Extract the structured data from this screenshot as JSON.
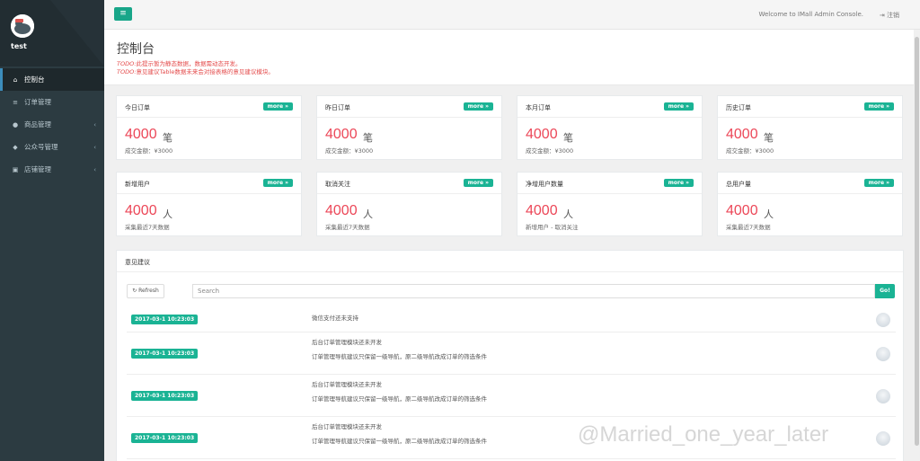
{
  "sidebar": {
    "user": "test",
    "items": [
      {
        "icon": "home-icon",
        "glyph": "⌂",
        "label": "控制台",
        "active": true,
        "has_chevron": false
      },
      {
        "icon": "list-icon",
        "glyph": "≡",
        "label": "订单管理",
        "active": false,
        "has_chevron": false
      },
      {
        "icon": "goods-icon",
        "glyph": "●",
        "label": "商品管理",
        "active": false,
        "has_chevron": true
      },
      {
        "icon": "wechat-icon",
        "glyph": "◆",
        "label": "公众号管理",
        "active": false,
        "has_chevron": true
      },
      {
        "icon": "shop-icon",
        "glyph": "▣",
        "label": "店铺管理",
        "active": false,
        "has_chevron": true
      }
    ]
  },
  "topbar": {
    "menu_glyph": "≡",
    "welcome": "Welcome to IMall Admin Console.",
    "logout": "注销",
    "logout_glyph": "⇥"
  },
  "page": {
    "title": "控制台",
    "todo1_prefix": "TODO:",
    "todo1_text": "此提示暂为静态数据，数据需动态开发。",
    "todo2_prefix": "TODO:",
    "todo2_text": "意见建议Table数据未来会对接表格的意见建议模块。"
  },
  "cards": [
    {
      "title": "今日订单",
      "more": "more »",
      "value": "4000",
      "unit": "笔",
      "sub": "成交金额：¥3000"
    },
    {
      "title": "昨日订单",
      "more": "more »",
      "value": "4000",
      "unit": "笔",
      "sub": "成交金额：¥3000"
    },
    {
      "title": "本月订单",
      "more": "more »",
      "value": "4000",
      "unit": "笔",
      "sub": "成交金额：¥3000"
    },
    {
      "title": "历史订单",
      "more": "more »",
      "value": "4000",
      "unit": "笔",
      "sub": "成交金额：¥3000"
    },
    {
      "title": "新增用户",
      "more": "more »",
      "value": "4000",
      "unit": "人",
      "sub": "采集最近7天数据"
    },
    {
      "title": "取消关注",
      "more": "more »",
      "value": "4000",
      "unit": "人",
      "sub": "采集最近7天数据"
    },
    {
      "title": "净增用户数量",
      "more": "more »",
      "value": "4000",
      "unit": "人",
      "sub": "新增用户 - 取消关注"
    },
    {
      "title": "总用户量",
      "more": "more »",
      "value": "4000",
      "unit": "人",
      "sub": "采集最近7天数据"
    }
  ],
  "feedback": {
    "title": "意见建议",
    "refresh": "Refresh",
    "search_placeholder": "Search",
    "go": "Go!",
    "rows": [
      {
        "date": "2017-03-1 10:23:03",
        "line1": "微信支付还未支持",
        "line2": ""
      },
      {
        "date": "2017-03-1 10:23:03",
        "line1": "后台订单管理模块还未开发",
        "line2": "订单管理导航建议只保留一级导航，原二级导航改成订单的筛选条件"
      },
      {
        "date": "2017-03-1 10:23:03",
        "line1": "后台订单管理模块还未开发",
        "line2": "订单管理导航建议只保留一级导航，原二级导航改成订单的筛选条件"
      },
      {
        "date": "2017-03-1 10:23:03",
        "line1": "后台订单管理模块还未开发",
        "line2": "订单管理导航建议只保留一级导航，原二级导航改成订单的筛选条件"
      }
    ]
  },
  "watermark": "@Married_one_year_later"
}
